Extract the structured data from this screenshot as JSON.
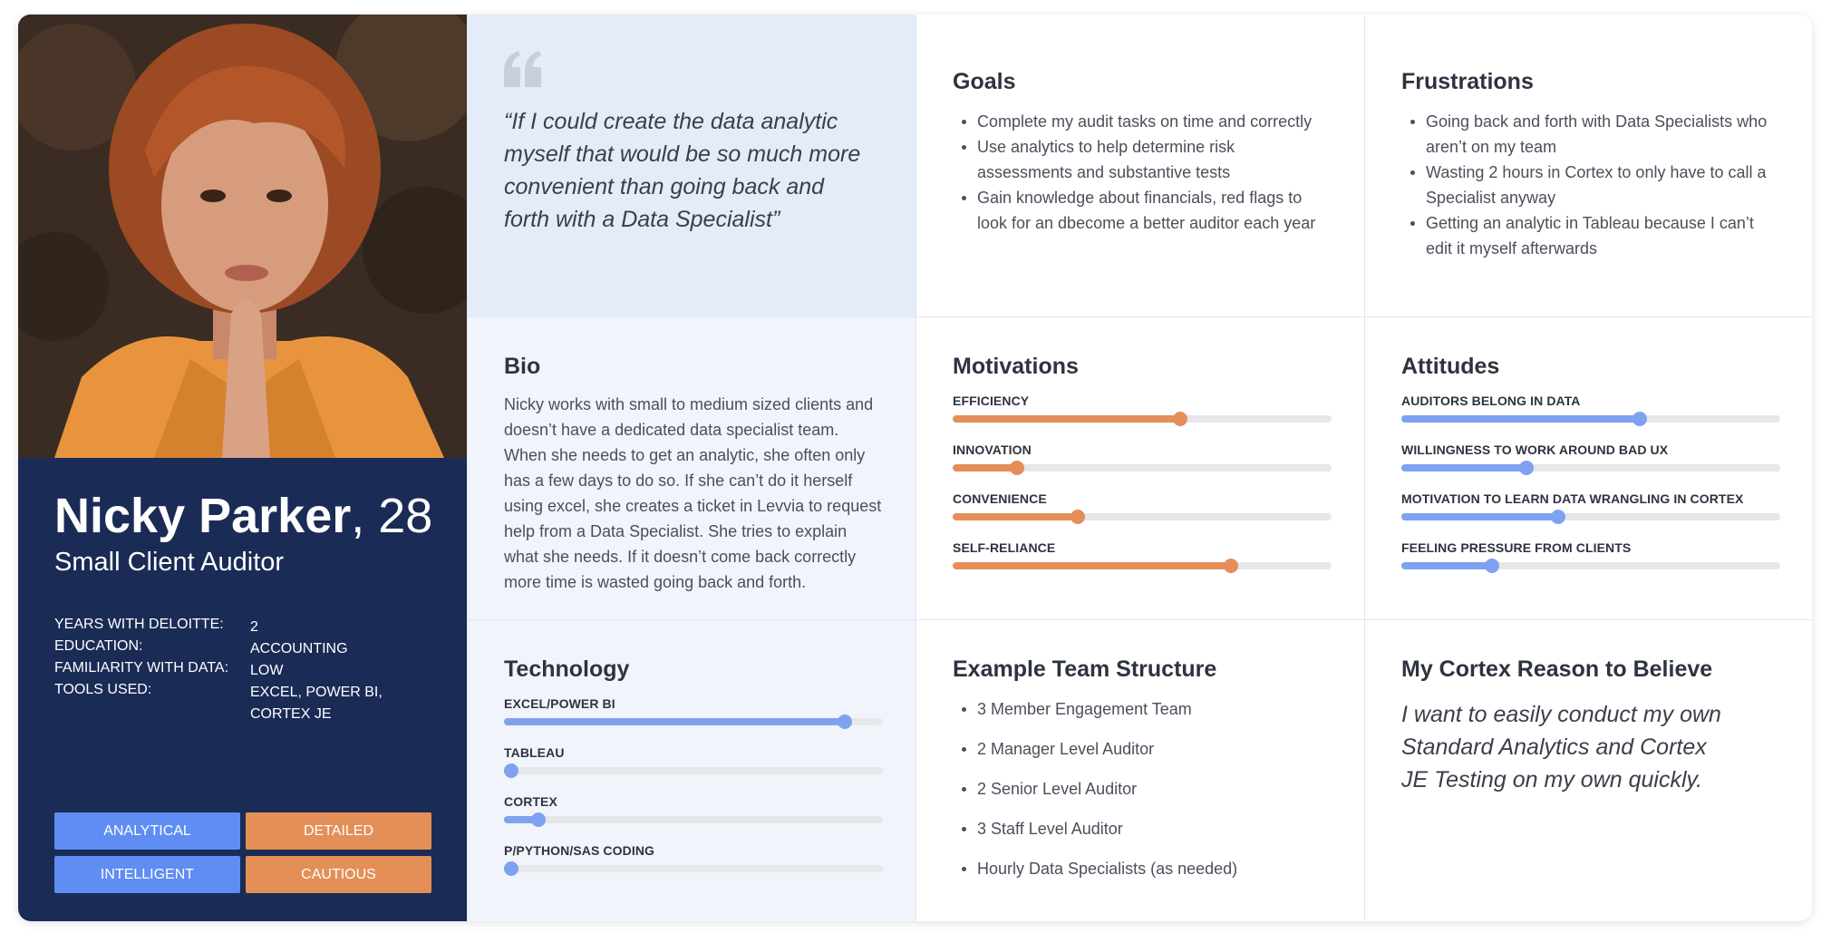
{
  "persona": {
    "name": "Nicky Parker",
    "age_suffix": ", 28",
    "role": "Small Client Auditor",
    "facts": [
      {
        "key": "YEARS WITH DELOITTE:",
        "value": "2"
      },
      {
        "key": "EDUCATION:",
        "value": "ACCOUNTING"
      },
      {
        "key": "FAMILIARITY WITH DATA:",
        "value": "LOW"
      },
      {
        "key": "TOOLS USED:",
        "value": "EXCEL, POWER BI, CORTEX JE"
      }
    ],
    "traits": [
      {
        "label": "ANALYTICAL",
        "color": "#5f8df3"
      },
      {
        "label": "DETAILED",
        "color": "#e38f57"
      },
      {
        "label": "INTELLIGENT",
        "color": "#5f8df3"
      },
      {
        "label": "CAUTIOUS",
        "color": "#e38f57"
      }
    ]
  },
  "quote": {
    "text": "“If I could create the data analytic myself that would be so much more convenient than going back and forth with a Data Specialist”"
  },
  "goals": {
    "title": "Goals",
    "items": [
      "Complete my audit tasks on time and correctly",
      "Use analytics to help determine risk assessments and substantive tests",
      "Gain knowledge about financials, red flags to look for an dbecome a better auditor each year"
    ]
  },
  "frustrations": {
    "title": "Frustrations",
    "items": [
      "Going back and forth with Data Specialists who aren’t on my team",
      "Wasting 2 hours in Cortex to only have to call a Specialist anyway",
      "Getting an analytic in Tableau because I can’t edit it myself afterwards"
    ]
  },
  "bio": {
    "title": "Bio",
    "text": "Nicky works with small to medium sized clients and doesn’t have a dedicated data specialist team. When she needs to get an analytic, she often only has a few days to do so. If she can’t do it herself using excel, she creates a ticket in Levvia to request help from a Data Specialist. She tries to explain what she needs. If it doesn’t come back correctly more time is wasted going back and forth."
  },
  "motivations": {
    "title": "Motivations",
    "items": [
      {
        "label": "EFFICIENCY",
        "value": 0.6
      },
      {
        "label": "INNOVATION",
        "value": 0.17
      },
      {
        "label": "CONVENIENCE",
        "value": 0.33
      },
      {
        "label": "SELF-RELIANCE",
        "value": 0.735
      }
    ]
  },
  "attitudes": {
    "title": "Attitudes",
    "items": [
      {
        "label": "AUDITORS BELONG IN DATA",
        "value": 0.63
      },
      {
        "label": "WILLINGNESS TO WORK AROUND BAD UX",
        "value": 0.33
      },
      {
        "label": "MOTIVATION TO LEARN DATA WRANGLING IN CORTEX",
        "value": 0.415
      },
      {
        "label": "FEELING PRESSURE FROM CLIENTS",
        "value": 0.24
      }
    ]
  },
  "technology": {
    "title": "Technology",
    "items": [
      {
        "label": "EXCEL/POWER BI",
        "value": 0.9
      },
      {
        "label": "TABLEAU",
        "value": 0.02
      },
      {
        "label": "CORTEX",
        "value": 0.09
      },
      {
        "label": "P/PYTHON/SAS CODING",
        "value": 0.02
      }
    ]
  },
  "team": {
    "title": "Example Team Structure",
    "items": [
      "3 Member Engagement Team",
      "2 Manager Level Auditor",
      "2 Senior Level Auditor",
      "3 Staff Level Auditor",
      "Hourly Data Specialists (as needed)"
    ]
  },
  "reason": {
    "title": "My Cortex Reason to Believe",
    "text": "I want to easily conduct my own Standard Analytics and Cortex JE Testing on my own quickly."
  },
  "colors": {
    "navy": "#1a2b55",
    "accent_blue": "#5f8df3",
    "accent_orange": "#e38f57",
    "quote_bg": "#e4ebf9"
  }
}
